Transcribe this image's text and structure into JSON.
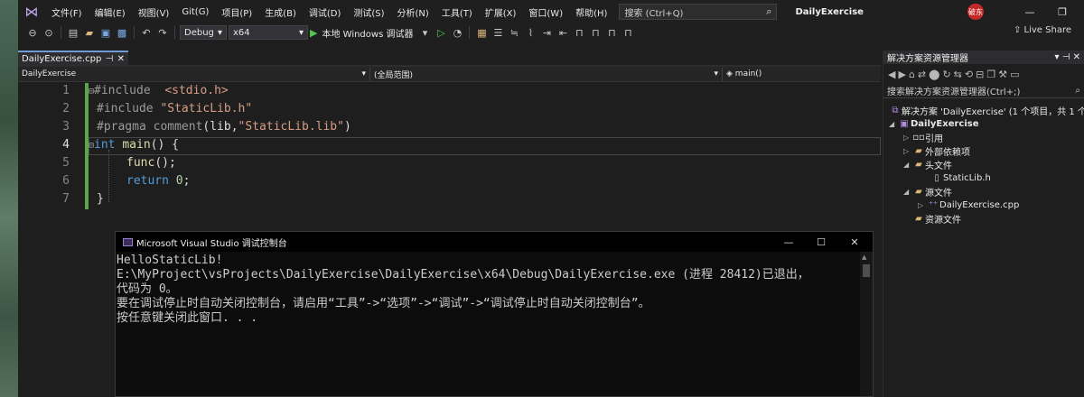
{
  "menu": {
    "items": [
      "文件(F)",
      "编辑(E)",
      "视图(V)",
      "Git(G)",
      "项目(P)",
      "生成(B)",
      "调试(D)",
      "测试(S)",
      "分析(N)",
      "工具(T)",
      "扩展(X)",
      "窗口(W)",
      "帮助(H)"
    ],
    "search_placeholder": "搜索 (Ctrl+Q)",
    "solution_title": "DailyExercise",
    "user_badge": "破东"
  },
  "toolbar": {
    "config": "Debug",
    "platform": "x64",
    "run_label": "本地 Windows 调试器",
    "live_share": "Live Share"
  },
  "editor": {
    "tab_name": "DailyExercise.cpp",
    "nav_project": "DailyExercise",
    "nav_scope": "(全局范围)",
    "nav_member": "main()",
    "line_numbers": [
      "1",
      "2",
      "3",
      "4",
      "5",
      "6",
      "7"
    ]
  },
  "console": {
    "title": "Microsoft Visual Studio 调试控制台",
    "lines": [
      "HelloStaticLib!",
      "E:\\MyProject\\vsProjects\\DailyExercise\\DailyExercise\\x64\\Debug\\DailyExercise.exe (进程 28412)已退出，",
      "代码为 0。",
      "要在调试停止时自动关闭控制台，请启用“工具”->“选项”->“调试”->“调试停止时自动关闭控制台”。",
      "按任意键关闭此窗口. . ."
    ]
  },
  "solution_explorer": {
    "title": "解决方案资源管理器",
    "search_placeholder": "搜索解决方案资源管理器(Ctrl+;)",
    "solution_label": "解决方案 'DailyExercise' (1 个项目，共 1 个)",
    "project": "DailyExercise",
    "references": "引用",
    "external_deps": "外部依赖项",
    "header_files": "头文件",
    "header_file": "StaticLib.h",
    "source_files": "源文件",
    "source_file": "DailyExercise.cpp",
    "resource_files": "资源文件"
  }
}
